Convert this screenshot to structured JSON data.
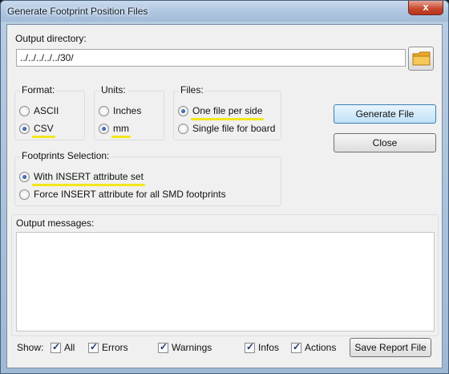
{
  "window": {
    "title": "Generate Footprint Position Files",
    "close_label": "x"
  },
  "output_directory": {
    "label": "Output directory:",
    "value": "../../../../../30/"
  },
  "format": {
    "title": "Format:",
    "options": [
      {
        "label": "ASCII",
        "checked": false
      },
      {
        "label": "CSV",
        "checked": true
      }
    ]
  },
  "units": {
    "title": "Units:",
    "options": [
      {
        "label": "Inches",
        "checked": false
      },
      {
        "label": "mm",
        "checked": true
      }
    ]
  },
  "files": {
    "title": "Files:",
    "options": [
      {
        "label": "One file per side",
        "checked": true
      },
      {
        "label": "Single file for board",
        "checked": false
      }
    ]
  },
  "footprints_selection": {
    "title": "Footprints Selection:",
    "options": [
      {
        "label": "With INSERT attribute set",
        "checked": true
      },
      {
        "label": "Force INSERT attribute for all SMD footprints",
        "checked": false
      }
    ]
  },
  "buttons": {
    "generate": "Generate File",
    "close": "Close",
    "save_report": "Save Report File"
  },
  "output_messages": {
    "label": "Output messages:"
  },
  "show": {
    "label": "Show:",
    "filters": [
      {
        "label": "All",
        "checked": true
      },
      {
        "label": "Errors",
        "checked": true
      },
      {
        "label": "Warnings",
        "checked": true
      },
      {
        "label": "Infos",
        "checked": true
      },
      {
        "label": "Actions",
        "checked": true
      }
    ]
  },
  "colors": {
    "highlight": "#f4e61a",
    "title_bar": "#aec5df",
    "close_button": "#c5462b"
  }
}
